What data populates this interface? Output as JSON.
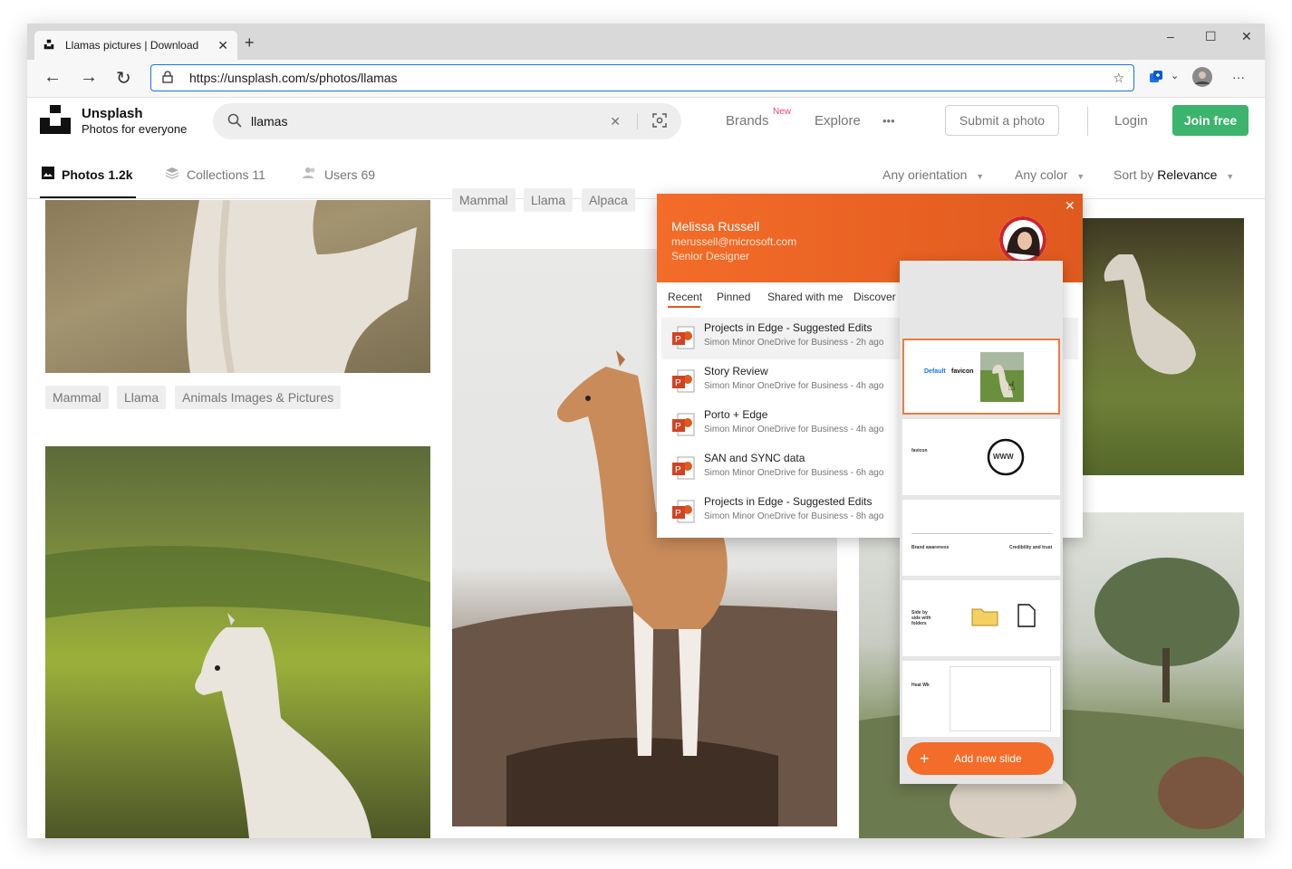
{
  "browser": {
    "tab_title": "Llamas pictures | Download",
    "new_tab": "+",
    "url": "https://unsplash.com/s/photos/llamas",
    "window_controls": {
      "minimize": "–",
      "maximize": "☐",
      "close": "✕"
    },
    "nav": {
      "back": "←",
      "forward": "→",
      "refresh": "↻"
    },
    "more": "···"
  },
  "site": {
    "brand_name": "Unsplash",
    "brand_tagline": "Photos for everyone",
    "search_value": "llamas",
    "nav": {
      "brands": "Brands",
      "new_badge": "New",
      "explore": "Explore",
      "more": "•••"
    },
    "submit": "Submit a photo",
    "login": "Login",
    "join": "Join free",
    "tabs": [
      {
        "label": "Photos 1.2k"
      },
      {
        "label": "Collections 11"
      },
      {
        "label": "Users 69"
      }
    ],
    "filters": {
      "orientation": "Any orientation",
      "color": "Any color",
      "sort_prefix": "Sort by",
      "sort_value": "Relevance"
    },
    "tags_col1": [
      "Mammal",
      "Llama",
      "Animals Images & Pictures"
    ],
    "tags_col2": [
      "Mammal",
      "Llama",
      "Alpaca"
    ]
  },
  "office_popup": {
    "user_name": "Melissa Russell",
    "user_email": "merussell@microsoft.com",
    "user_role": "Senior Designer",
    "tabs": [
      "Recent",
      "Pinned",
      "Shared with me",
      "Discover"
    ],
    "files": [
      {
        "title": "Projects in Edge - Suggested Edits",
        "meta": "Simon Minor OneDrive for Business - 2h ago"
      },
      {
        "title": "Story Review",
        "meta": "Simon Minor OneDrive for Business - 4h ago"
      },
      {
        "title": "Porto + Edge",
        "meta": "Simon Minor OneDrive for Business - 4h ago"
      },
      {
        "title": "SAN and SYNC data",
        "meta": "Simon Minor OneDrive for Business - 6h ago"
      },
      {
        "title": "Projects in Edge - Suggested Edits",
        "meta": "Simon Minor OneDrive for Business - 8h ago"
      }
    ]
  },
  "slides": {
    "s1_title_a": "Default",
    "s1_title_b": "favicon",
    "s2_title": "favicon",
    "s2_www": "WWW",
    "s3_left": "Brand awareness",
    "s3_right": "Credibility and trust",
    "s4_title": "Side by side with folders",
    "s5_title": "Heat Wk",
    "add_label": "Add new slide"
  },
  "colors": {
    "accent_orange": "#f36c29",
    "join_green": "#3cb46e",
    "address_border": "#1a73e8"
  }
}
